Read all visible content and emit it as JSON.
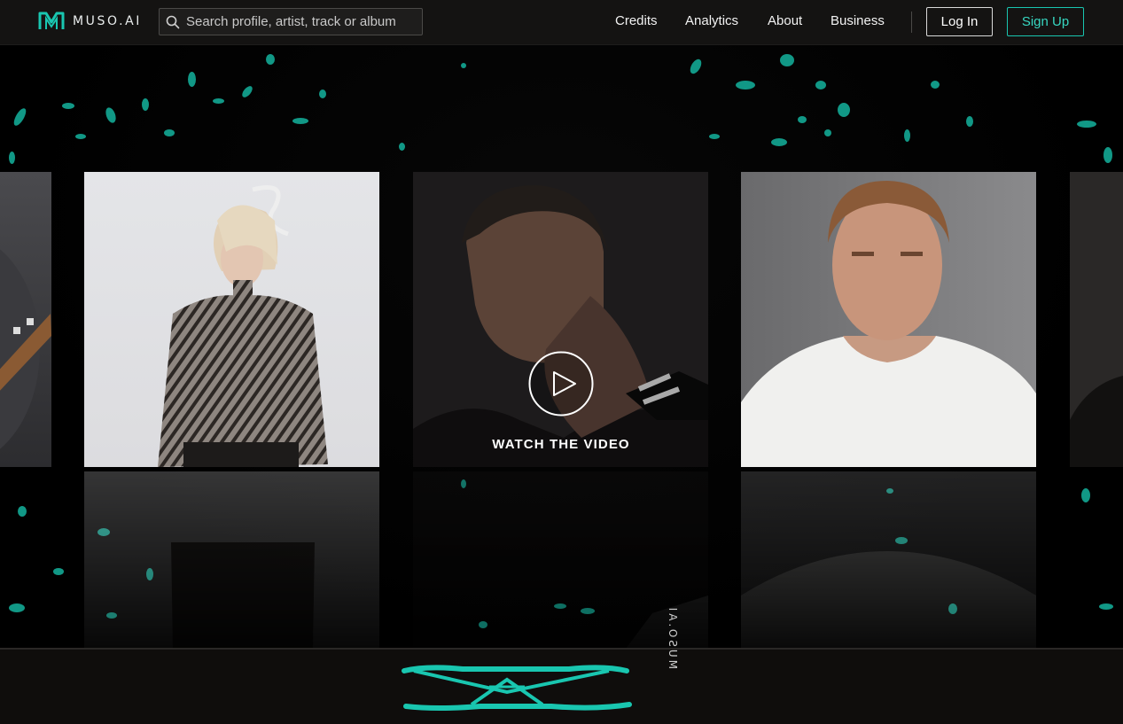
{
  "header": {
    "logo_text": "MUSO.AI",
    "search_placeholder": "Search profile, artist, track or album",
    "nav": [
      "Credits",
      "Analytics",
      "About",
      "Business"
    ],
    "login_label": "Log In",
    "signup_label": "Sign Up"
  },
  "hero": {
    "cta_label": "WATCH THE VIDEO",
    "tiles": [
      "artist-photo-guitarist",
      "artist-photo-woman",
      "artist-photo-man-tattoo",
      "artist-photo-man-white-tee",
      "artist-photo-edge"
    ]
  },
  "band": {
    "logo_text": "MUSO.AI"
  },
  "colors": {
    "accent": "#19c6b0",
    "header_bg": "#141312",
    "hero_bg": "#000000"
  },
  "icons": [
    "muso-logo-icon",
    "search-icon",
    "play-icon"
  ]
}
